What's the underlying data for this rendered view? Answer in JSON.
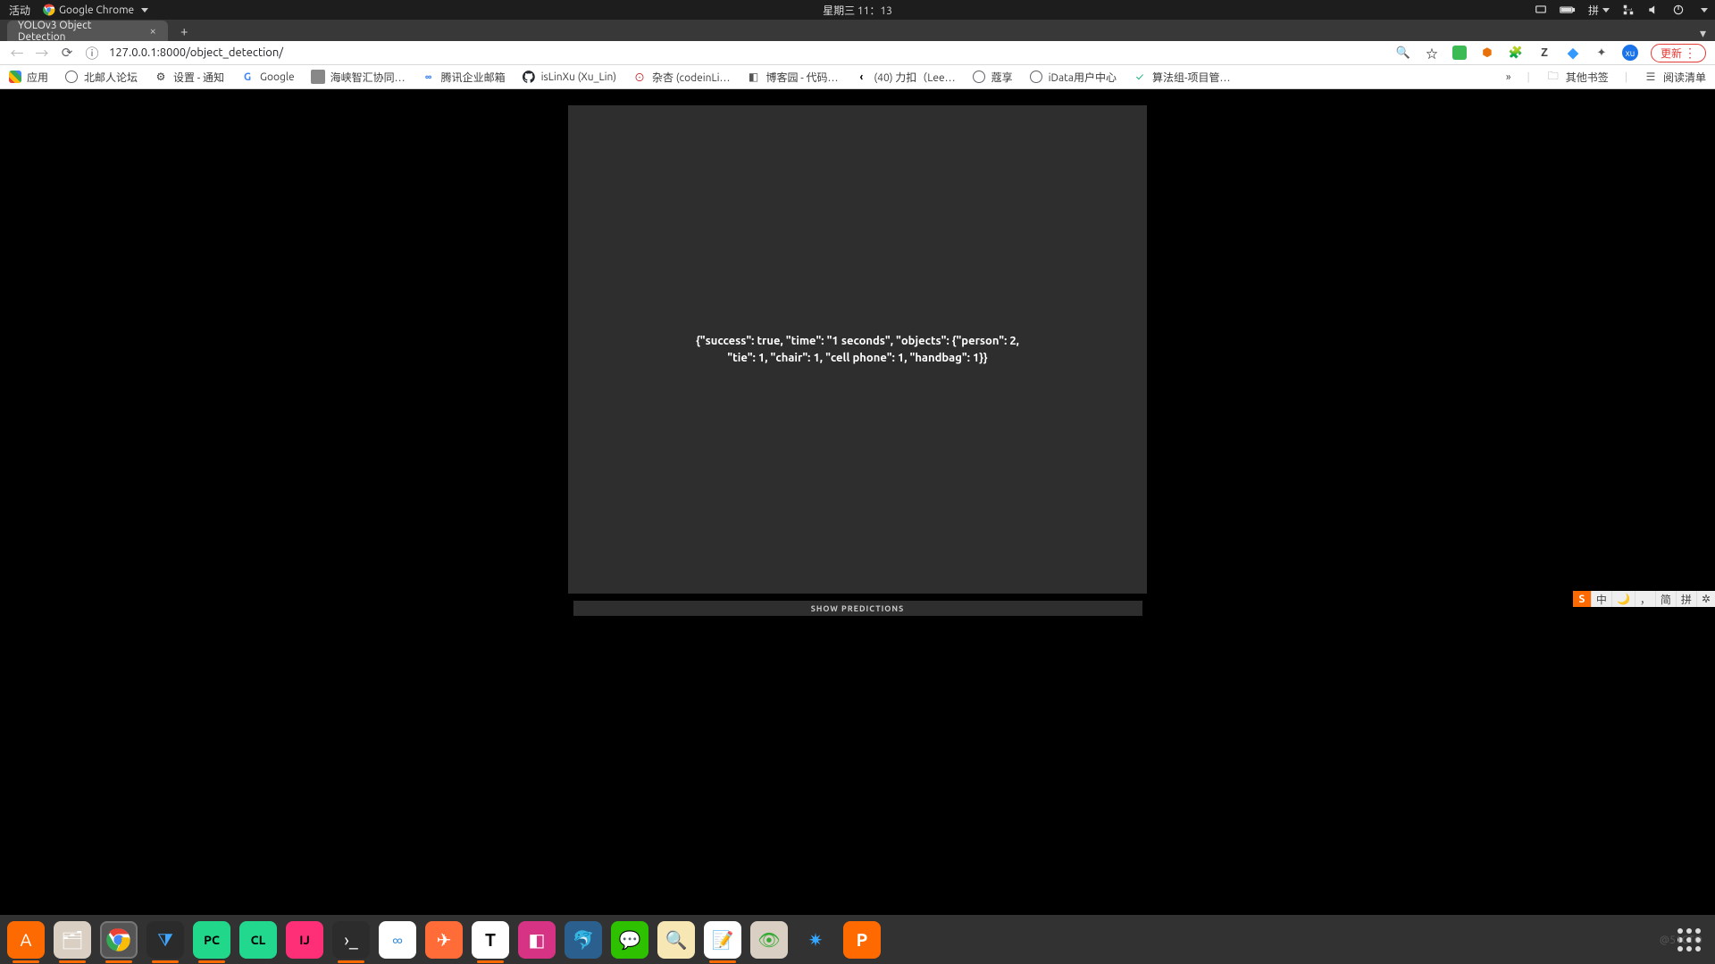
{
  "gnome": {
    "activities": "活动",
    "app_name": "Google Chrome",
    "clock": "星期三 11：13",
    "ime_indicator": "拼"
  },
  "chrome": {
    "tab_title": "YOLOv3 Object Detection",
    "url": "127.0.0.1:8000/object_detection/",
    "update_label": "更新"
  },
  "bookmarks": {
    "apps": "应用",
    "items": [
      "北邮人论坛",
      "设置 - 通知",
      "Google",
      "海峡智汇协同…",
      "腾讯企业邮箱",
      "isLinXu (Xu_Lin)",
      "杂杏 (codeinLi…",
      "博客园 - 代码…",
      "(40) 力扣（Lee…",
      "蔻享",
      "iData用户中心",
      "算法组-项目管…"
    ],
    "overflow": "»",
    "other": "其他书签",
    "reading_list": "阅读清单"
  },
  "page": {
    "json_line1": "{\"success\": true, \"time\": \"1 seconds\", \"objects\": {\"person\": 2,",
    "json_line2": "\"tie\": 1, \"chair\": 1, \"cell phone\": 1, \"handbag\": 1}}",
    "show_btn": "SHOW PREDICTIONS"
  },
  "ime_bar": {
    "cells": [
      "中",
      "🌙",
      "，",
      "简",
      "拼",
      "✲"
    ]
  },
  "watermark": "@51CTO"
}
